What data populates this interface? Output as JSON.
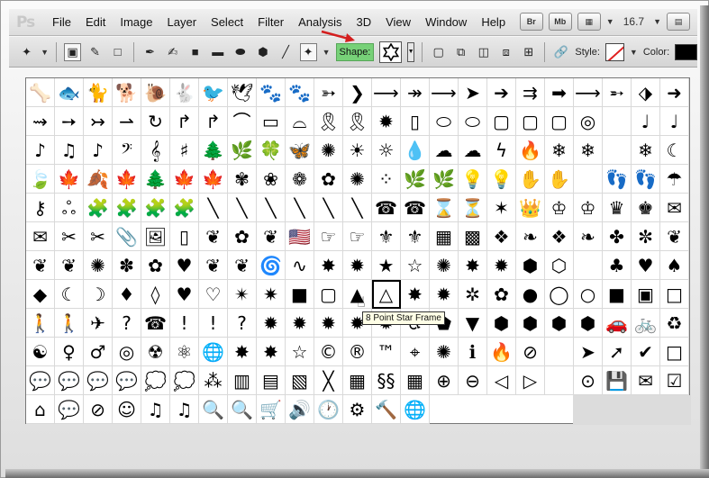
{
  "app": {
    "logo": "Ps"
  },
  "menubar": {
    "items": [
      "File",
      "Edit",
      "Image",
      "Layer",
      "Select",
      "Filter",
      "Analysis",
      "3D",
      "View",
      "Window",
      "Help"
    ],
    "right": {
      "br": "Br",
      "mb": "Mb",
      "zoom": "16.7"
    }
  },
  "optionsbar": {
    "shape_label": "Shape:",
    "style_label": "Style:",
    "color_label": "Color:",
    "accent": "#77d178",
    "color_value": "#000000"
  },
  "tooltip": {
    "text": "8 Point Star Frame"
  },
  "shapes": [
    "🦴",
    "🐟",
    "🐈",
    "🐕",
    "🐌",
    "🐇",
    "🐦",
    "🕊",
    "🐾",
    "🐾",
    "➳",
    "❯",
    "⟶",
    "↠",
    "⟶",
    "➤",
    "➔",
    "⇉",
    "➡",
    "⟶",
    "➵",
    "⬗",
    "➜",
    "⇝",
    "➙",
    "↣",
    "⇀",
    "↻",
    "↱",
    "↱",
    "⌒",
    "▭",
    "⌓",
    "🎗",
    "🎗",
    "✹",
    "▯",
    "⬭",
    "⬭",
    "▢",
    "▢",
    "▢",
    "◎",
    "",
    "♩",
    "♩",
    "♪",
    "♫",
    "♪",
    "𝄢",
    "𝄞",
    "♯",
    "🌲",
    "🌿",
    "🍀",
    "🦋",
    "✺",
    "☀",
    "☼",
    "💧",
    "☁",
    "☁",
    "ϟ",
    "🔥",
    "❄",
    "❄",
    "",
    "❄",
    "☾",
    "🍃",
    "🍁",
    "🍂",
    "🍁",
    "🌲",
    "🍁",
    "🍁",
    "✾",
    "❀",
    "❁",
    "✿",
    "✺",
    "⁘",
    "🌿",
    "🌿",
    "💡",
    "💡",
    "✋",
    "✋",
    "",
    "👣",
    "👣",
    "☂",
    "⚷",
    "ஃ",
    "🧩",
    "🧩",
    "🧩",
    "🧩",
    "╲",
    "╲",
    "╲",
    "╲",
    "╲",
    "╲",
    "☎",
    "☎",
    "⌛",
    "⏳",
    "✶",
    "👑",
    "♔",
    "♔",
    "♛",
    "♚",
    "✉",
    "✉",
    "✂",
    "✂",
    "📎",
    "🖼",
    "▯",
    "❦",
    "✿",
    "❦",
    "🇺🇸",
    "☞",
    "☞",
    "⚜",
    "⚜",
    "▦",
    "▩",
    "❖",
    "❧",
    "❖",
    "❧",
    "✤",
    "✼",
    "❦",
    "❦",
    "❦",
    "✺",
    "✽",
    "✿",
    "♥",
    "❦",
    "❦",
    "🌀",
    "∿",
    "✸",
    "✹",
    "★",
    "☆",
    "✺",
    "✸",
    "✹",
    "⬢",
    "⬡",
    "",
    "♣",
    "♥",
    "♠",
    "◆",
    "☾",
    "☽",
    "♦",
    "◊",
    "♥",
    "♡",
    "✴",
    "✷",
    "■",
    "▢",
    "▲",
    "△",
    "✸",
    "✹",
    "✲",
    "✿",
    "●",
    "◯",
    "○",
    "■",
    "▣",
    "□",
    "🚶",
    "🚶",
    "✈",
    "?",
    "☎",
    "!",
    "!",
    "?",
    "✹",
    "✹",
    "✹",
    "✹",
    "✹",
    "♿",
    "⬟",
    "▼",
    "⬢",
    "⬢",
    "⬢",
    "⬢",
    "🚗",
    "🚲",
    "♻",
    "☯",
    "♀",
    "♂",
    "◎",
    "☢",
    "⚛",
    "🌐",
    "✸",
    "✸",
    "☆",
    "©",
    "®",
    "™",
    "⌖",
    "✺",
    "ℹ",
    "🔥",
    "⊘",
    "",
    "➤",
    "➚",
    "✔",
    "□",
    "💬",
    "💬",
    "💬",
    "💬",
    "💭",
    "💭",
    "⁂",
    "▥",
    "▤",
    "▧",
    "╳",
    "▦",
    "§§",
    "▦",
    "⊕",
    "⊖",
    "◁",
    "▷",
    "",
    "⊙",
    "💾",
    "✉",
    "☑",
    "⌂",
    "💬",
    "⊘",
    "☺",
    "♫",
    "♫",
    "🔍",
    "🔍",
    "🛒",
    "🔊",
    "🕐",
    "⚙",
    "🔨",
    "🌐"
  ]
}
